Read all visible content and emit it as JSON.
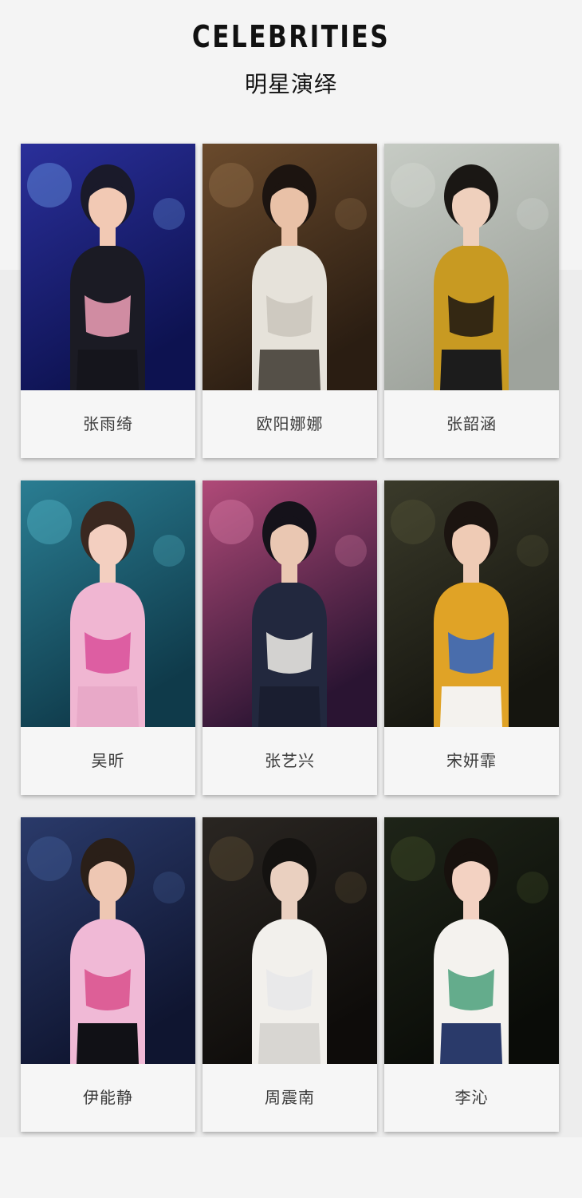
{
  "header": {
    "title_en": "CELEBRITIES",
    "title_cn": "明星演绎"
  },
  "celebrities": [
    {
      "name": "张雨绮",
      "scene": "stage-blue",
      "colors": {
        "bg1": "#2a2f9a",
        "bg2": "#0d1250",
        "accent": "#7fb6ff",
        "skin": "#f2c9b4",
        "hair": "#1a1a2a",
        "top": "#1b1b24",
        "detail": "#f0a0b8",
        "bottom": "#15151c"
      }
    },
    {
      "name": "欧阳娜娜",
      "scene": "interior-brown",
      "colors": {
        "bg1": "#6a4a2c",
        "bg2": "#2a1d12",
        "accent": "#a07a52",
        "skin": "#e9c1a7",
        "hair": "#1c1410",
        "top": "#e6e2da",
        "detail": "#c9c4bb",
        "bottom": "#555048"
      }
    },
    {
      "name": "张韶涵",
      "scene": "studio-grey",
      "colors": {
        "bg1": "#c6cbc4",
        "bg2": "#9ea39c",
        "accent": "#d9dcd6",
        "skin": "#efd0bd",
        "hair": "#1a1714",
        "top": "#c89a22",
        "detail": "#1a1410",
        "bottom": "#1c1c1c"
      }
    },
    {
      "name": "吴昕",
      "scene": "stage-teal",
      "colors": {
        "bg1": "#2a7d92",
        "bg2": "#0f3a4a",
        "accent": "#5fc6d6",
        "skin": "#f3cfc0",
        "hair": "#3a2820",
        "top": "#f0b6d2",
        "detail": "#d94f9a",
        "bottom": "#e8a9c8"
      }
    },
    {
      "name": "张艺兴",
      "scene": "stage-pink",
      "colors": {
        "bg1": "#b04a78",
        "bg2": "#2a1432",
        "accent": "#e98ab4",
        "skin": "#eac7b2",
        "hair": "#15121a",
        "top": "#22283e",
        "detail": "#f2f0ea",
        "bottom": "#1a1e30"
      }
    },
    {
      "name": "宋妍霏",
      "scene": "outdoor-dark",
      "colors": {
        "bg1": "#3a3a2a",
        "bg2": "#15150f",
        "accent": "#5a5a3a",
        "skin": "#efcbb5",
        "hair": "#1b1410",
        "top": "#e0a326",
        "detail": "#2e64c4",
        "bottom": "#f4f2ee"
      }
    },
    {
      "name": "伊能静",
      "scene": "stage-navy",
      "colors": {
        "bg1": "#2a3a6a",
        "bg2": "#0f1530",
        "accent": "#4a6aa8",
        "skin": "#eec7b3",
        "hair": "#2a1f18",
        "top": "#f0b9d6",
        "detail": "#d94f8c",
        "bottom": "#111116"
      }
    },
    {
      "name": "周震南",
      "scene": "street-night",
      "colors": {
        "bg1": "#2a2622",
        "bg2": "#0e0c0a",
        "accent": "#6a5a3a",
        "skin": "#ead0c0",
        "hair": "#141210",
        "top": "#f2f0ec",
        "detail": "#e8e8ea",
        "bottom": "#d8d6d2"
      }
    },
    {
      "name": "李沁",
      "scene": "night-bokeh",
      "colors": {
        "bg1": "#1e2418",
        "bg2": "#0a0c08",
        "accent": "#4a5a2a",
        "skin": "#f3d2c2",
        "hair": "#17110d",
        "top": "#f4f2ee",
        "detail": "#4aa07a",
        "bottom": "#2a3a6a"
      }
    }
  ]
}
